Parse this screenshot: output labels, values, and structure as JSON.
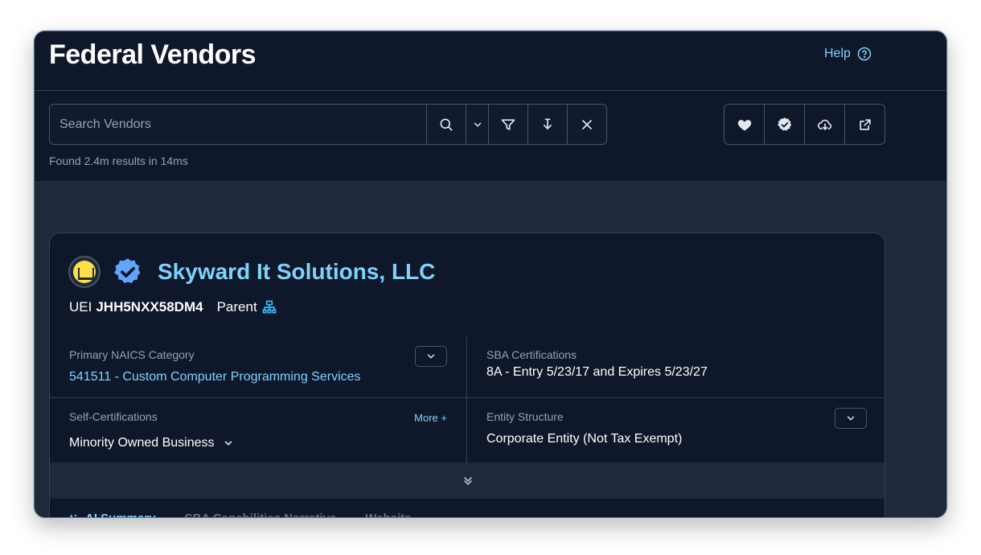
{
  "header": {
    "title": "Federal Vendors",
    "help_label": "Help"
  },
  "search": {
    "placeholder": "Search Vendors",
    "value": "",
    "results_text": "Found 2.4m results in 14ms"
  },
  "icons": {
    "search": "search-icon",
    "dropdown": "chevron-down-icon",
    "filter": "filter-icon",
    "sort": "sort-down-icon",
    "clear": "close-icon",
    "favorite": "heart-icon",
    "certified": "badge-check-icon",
    "download": "cloud-download-icon",
    "share": "share-icon"
  },
  "vendor": {
    "name": "Skyward It Solutions, LLC",
    "uei_label": "UEI",
    "uei": "JHH5NXX58DM4",
    "parent_label": "Parent",
    "naics": {
      "label": "Primary NAICS Category",
      "value": "541511 - Custom Computer Programming Services"
    },
    "sba": {
      "label": "SBA Certifications",
      "value": "8A - Entry 5/23/17 and Expires 5/23/27"
    },
    "self_cert": {
      "label": "Self-Certifications",
      "more_label": "More +",
      "value": "Minority Owned Business"
    },
    "entity": {
      "label": "Entity Structure",
      "value": "Corporate Entity (Not Tax Exempt)"
    }
  },
  "tabs": [
    {
      "label": "AI Summary"
    },
    {
      "label": "SBA Capabilities Narrative"
    },
    {
      "label": "Website"
    }
  ],
  "colors": {
    "accent": "#7dd3fc",
    "background": "#0f172a",
    "panel": "#1e293b",
    "verified": "#60a5fa"
  }
}
